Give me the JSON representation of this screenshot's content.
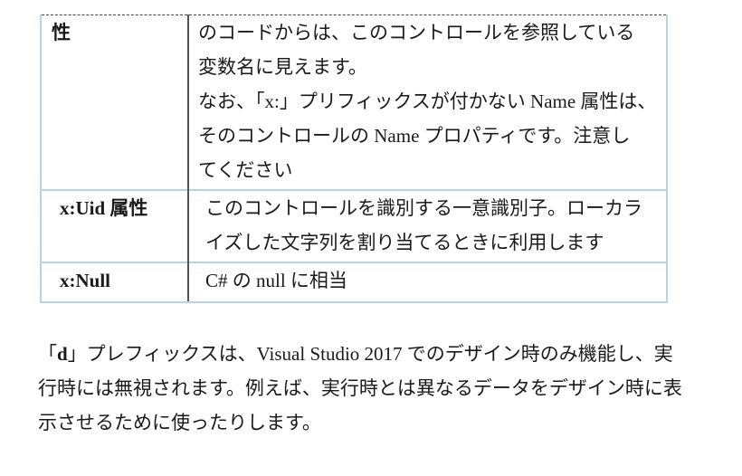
{
  "table": {
    "rows": [
      {
        "key": "性",
        "value_lines": [
          "のコードからは、このコントロールを参照している",
          "変数名に見えます。",
          "なお、「x:」プリフィックスが付かない Name 属性は、",
          "そのコントロールの Name プロパティです。注意し",
          "てください"
        ]
      },
      {
        "key": "x:Uid 属性",
        "value_lines": [
          "このコントロールを識別する一意識別子。ローカラ",
          "イズした文字列を割り当てるときに利用します"
        ]
      },
      {
        "key": "x:Null",
        "value_lines": [
          "C# の null に相当"
        ]
      }
    ]
  },
  "paragraph": {
    "open_bracket": "「",
    "bold_text": "d",
    "line1_rest": "」プレフィックスは、Visual Studio 2017 でのデザイン時のみ機能し、実",
    "line2": "行時には無視されます。例えば、実行時とは異なるデータをデザイン時に表",
    "line3": "示させるために使ったりします。"
  }
}
